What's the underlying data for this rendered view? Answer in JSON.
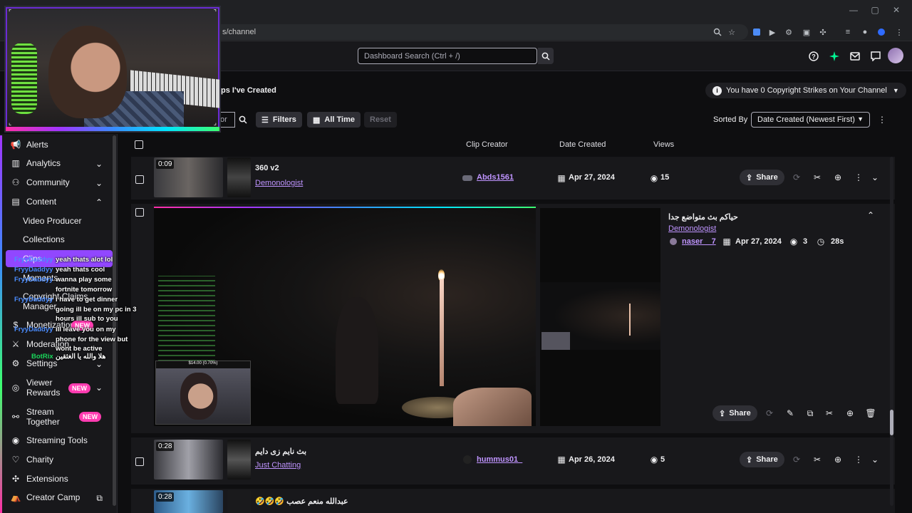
{
  "browser": {
    "url_tail": "s/channel",
    "window_controls": [
      "—",
      "▢",
      "✕"
    ]
  },
  "topnav": {
    "search_placeholder": "Dashboard Search (Ctrl + /)",
    "icons": [
      "help-icon",
      "sparkle-icon",
      "inbox-icon",
      "whisper-icon",
      "avatar"
    ]
  },
  "page": {
    "header": "ps I've Created",
    "copyright_notice": "You have 0 Copyright Strikes on Your Channel",
    "filter_input_tail": "or",
    "filters_label": "Filters",
    "time_label": "All Time",
    "reset_label": "Reset",
    "sorted_by_label": "Sorted By",
    "sort_value": "Date Created (Newest First)"
  },
  "table": {
    "columns": [
      "Clip Creator",
      "Date Created",
      "Views"
    ]
  },
  "clips": [
    {
      "duration": "0:09",
      "title": "360 v2",
      "category": "Demonologist",
      "creator": "Abds1561",
      "date": "Apr 27, 2024",
      "views": "15",
      "share": "Share"
    },
    {
      "title": "حياكم بث متواضع جدا",
      "category": "Demonologist",
      "creator": "naser__7",
      "date": "Apr 27, 2024",
      "views": "3",
      "length": "28s",
      "share": "Share",
      "overlay_donation": "$14.00 (0.70%)"
    },
    {
      "duration": "0:28",
      "title": "بث نايم زى دايم",
      "category": "Just Chatting",
      "creator": "hummus01_",
      "date": "Apr 26, 2024",
      "views": "5",
      "share": "Share"
    },
    {
      "duration": "0:28",
      "title": "عبدالله منعم عصب 🤣🤣🤣"
    }
  ],
  "sidebar": {
    "items": [
      {
        "label": "Alerts",
        "icon": "megaphone-icon"
      },
      {
        "label": "Analytics",
        "icon": "chart-icon"
      },
      {
        "label": "Community",
        "icon": "community-icon"
      },
      {
        "label": "Content",
        "icon": "content-icon"
      },
      {
        "label": "Monetization",
        "icon": "money-icon"
      },
      {
        "label": "Moderation",
        "icon": "sword-icon"
      },
      {
        "label": "Settings",
        "icon": "gear-icon"
      },
      {
        "label": "Viewer Rewards",
        "icon": "rewards-icon"
      },
      {
        "label": "Stream Together",
        "icon": "people-icon"
      },
      {
        "label": "Streaming Tools",
        "icon": "broadcast-icon"
      },
      {
        "label": "Charity",
        "icon": "heart-icon"
      },
      {
        "label": "Extensions",
        "icon": "puzzle-icon"
      },
      {
        "label": "Creator Camp",
        "icon": "camp-icon"
      }
    ],
    "content_subitems": [
      "Video Producer",
      "Collections",
      "Clips",
      "Moments",
      "Copyright Claims",
      "Manager"
    ],
    "viewer_rewards_line1": "Viewer",
    "viewer_rewards_line2": "Rewards",
    "stream_together_line1": "Stream",
    "stream_together_line2": "Together",
    "new_badge": "NEW"
  },
  "chat_overlay": [
    {
      "name": "FryyDaddyy",
      "msg": "yeah thats alot lol"
    },
    {
      "name": "FryyDaddyy",
      "msg": "yeah thats cool"
    },
    {
      "name": "FryyDaddyy",
      "msg": "wanna play some fortnite tomorrow"
    },
    {
      "name": "FryyDaddyy",
      "msg": "i have to get dinner going ill be on my pc in 3 hours ill sub to you"
    },
    {
      "name": "FryyDaddyy",
      "msg": "ill leave you on my phone for the view but wont be active"
    },
    {
      "name": "BotRix",
      "msg": "هلا والله يا الغثقين"
    }
  ],
  "colors": {
    "accent": "#9147ff",
    "link": "#bf94ff",
    "new_badge": "#ff3cb1",
    "background": "#0e0e10"
  }
}
